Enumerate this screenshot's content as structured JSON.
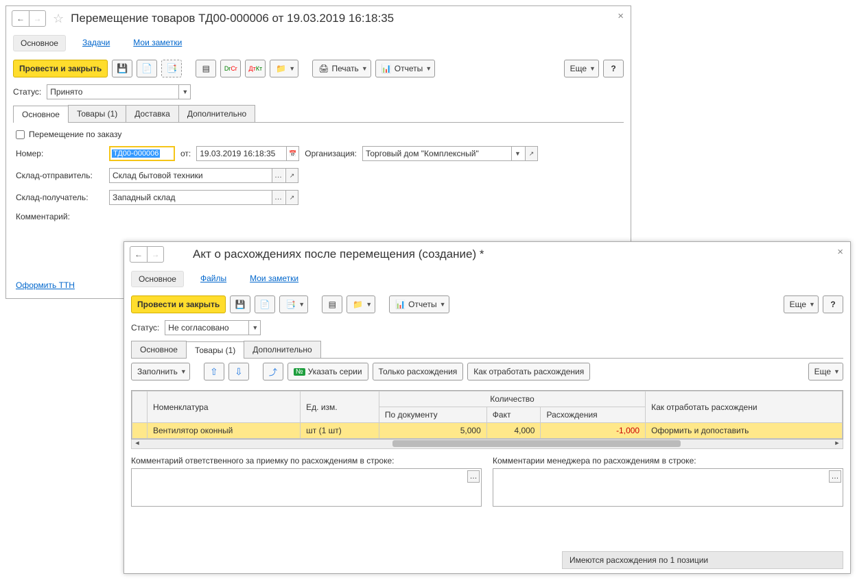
{
  "win1": {
    "title": "Перемещение товаров ТД00-000006 от 19.03.2019 16:18:35",
    "section_tabs": [
      "Основное",
      "Задачи",
      "Мои заметки"
    ],
    "post_close": "Провести и закрыть",
    "print": "Печать",
    "reports": "Отчеты",
    "more": "Еще",
    "status_label": "Статус:",
    "status_value": "Принято",
    "subtabs": [
      "Основное",
      "Товары (1)",
      "Доставка",
      "Дополнительно"
    ],
    "move_by_order": "Перемещение по заказу",
    "number_label": "Номер:",
    "number_value": "ТД00-000006",
    "from_label": "от:",
    "date_value": "19.03.2019 16:18:35",
    "org_label": "Организация:",
    "org_value": "Торговый дом \"Комплексный\"",
    "sender_label": "Склад-отправитель:",
    "sender_value": "Склад бытовой техники",
    "receiver_label": "Склад-получатель:",
    "receiver_value": "Западный склад",
    "comment_label": "Комментарий:",
    "ttn_link": "Оформить ТТН"
  },
  "win2": {
    "title": "Акт о расхождениях после перемещения (создание) *",
    "section_tabs": [
      "Основное",
      "Файлы",
      "Мои заметки"
    ],
    "post_close": "Провести и закрыть",
    "reports": "Отчеты",
    "more": "Еще",
    "status_label": "Статус:",
    "status_value": "Не согласовано",
    "subtabs": [
      "Основное",
      "Товары (1)",
      "Дополнительно"
    ],
    "fill": "Заполнить",
    "specify_series": "Указать серии",
    "only_discrep": "Только расхождения",
    "how_handle": "Как отработать расхождения",
    "table": {
      "headers": {
        "nomen": "Номенклатура",
        "unit": "Ед. изм.",
        "qty_group": "Количество",
        "by_doc": "По документу",
        "fact": "Факт",
        "discrep": "Расхождения",
        "action": "Как отработать расхождени"
      },
      "rows": [
        {
          "nomen": "Вентилятор оконный",
          "unit": "шт (1 шт)",
          "by_doc": "5,000",
          "fact": "4,000",
          "discrep": "-1,000",
          "action": "Оформить и допоставить"
        }
      ]
    },
    "comment1_label": "Комментарий ответственного за приемку по расхождениям в строке:",
    "comment2_label": "Комментарии менеджера по расхождениям в строке:",
    "status_bar": "Имеются расхождения по 1 позиции"
  }
}
